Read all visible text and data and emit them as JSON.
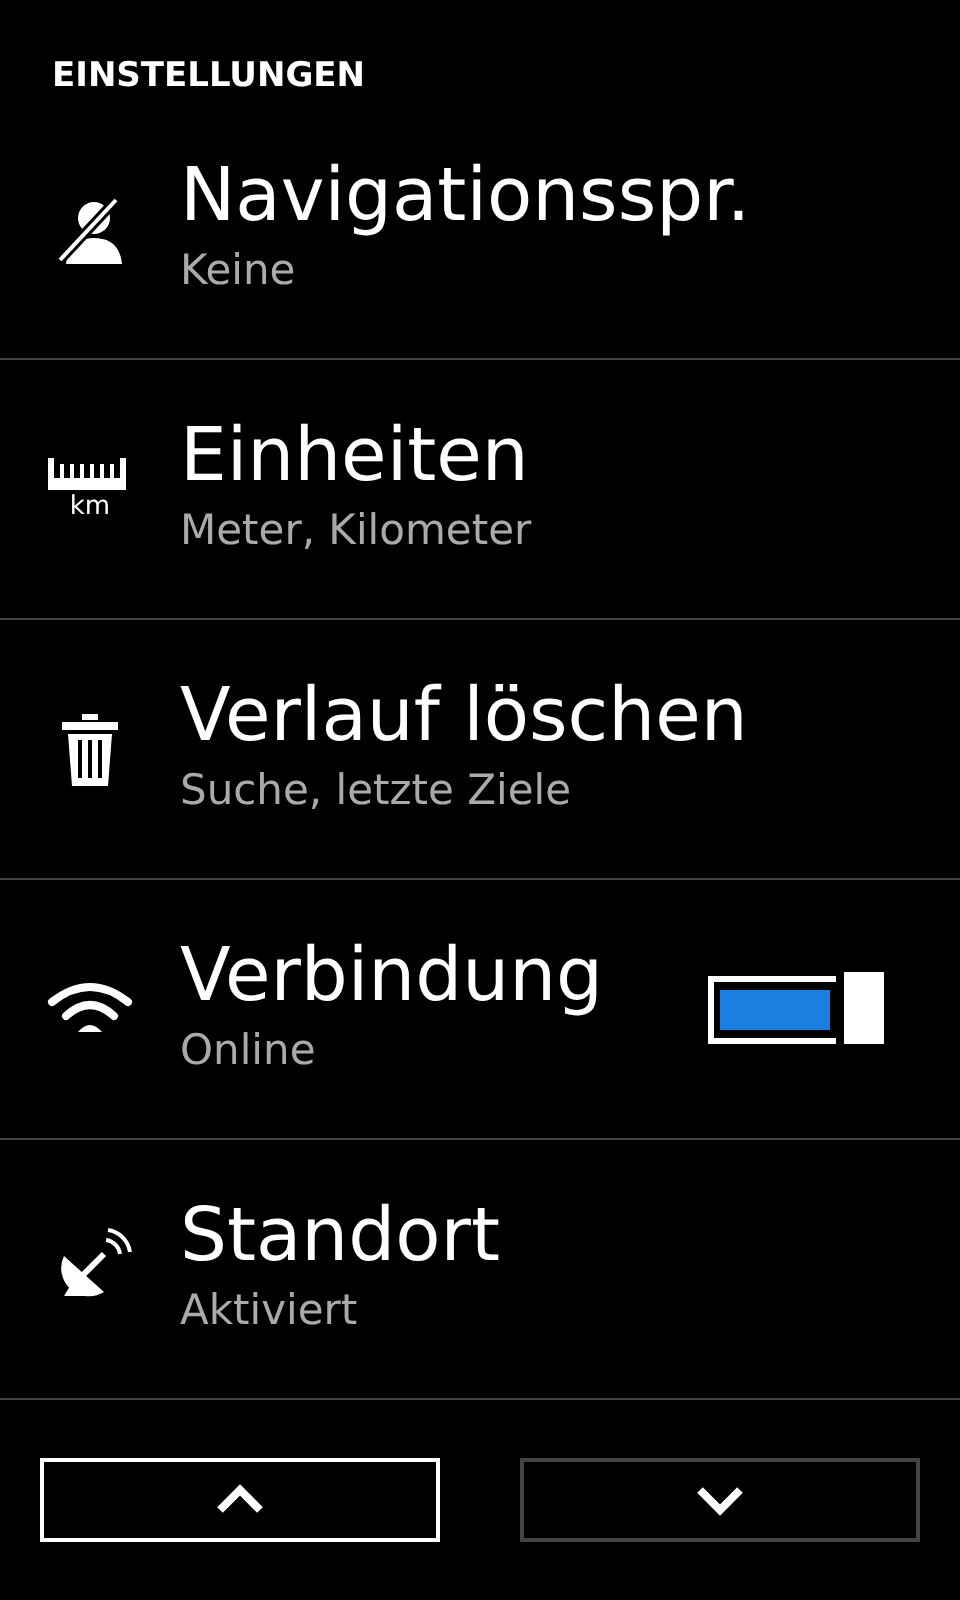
{
  "header": "EINSTELLUNGEN",
  "items": [
    {
      "kind": "voice-off",
      "title": "Navigationsspr.",
      "subtitle": "Keine"
    },
    {
      "kind": "ruler",
      "icon_text": "km",
      "title": "Einheiten",
      "subtitle": "Meter, Kilometer"
    },
    {
      "kind": "trash",
      "title": "Verlauf löschen",
      "subtitle": "Suche, letzte Ziele"
    },
    {
      "kind": "wifi",
      "title": "Verbindung",
      "subtitle": "Online",
      "toggle": {
        "on": true
      }
    },
    {
      "kind": "satellite",
      "title": "Standort",
      "subtitle": "Aktiviert"
    }
  ],
  "nav_buttons": [
    {
      "kind": "up",
      "selected": true
    },
    {
      "kind": "down",
      "selected": false
    }
  ]
}
